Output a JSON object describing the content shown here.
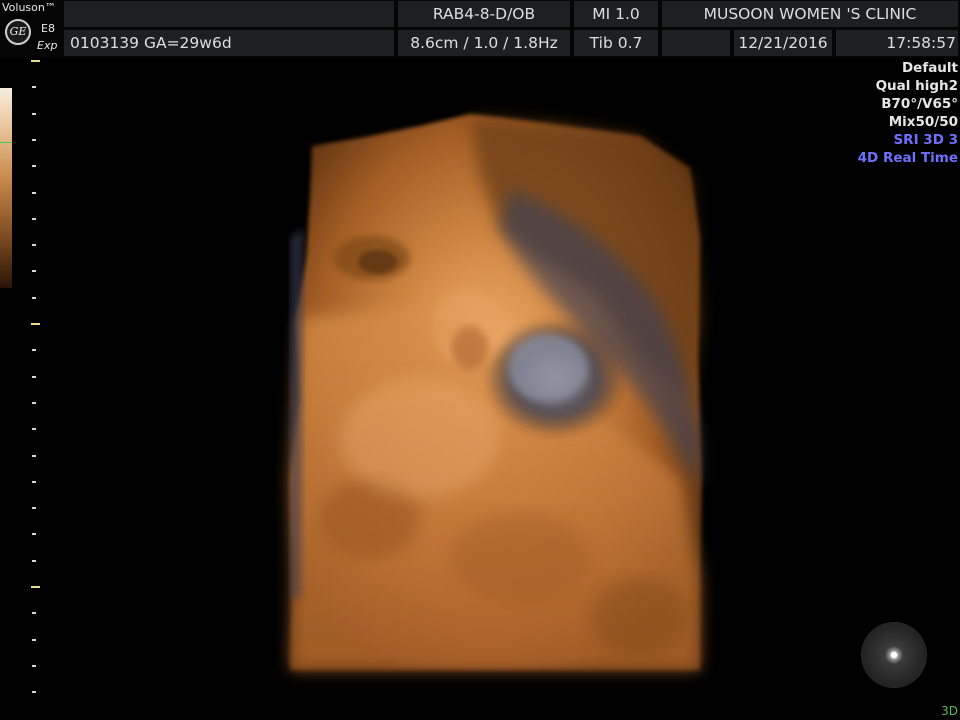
{
  "header": {
    "brand": "Voluson™",
    "logo_text": "GE",
    "model": "E8",
    "model_sub": "Exp",
    "probe": "RAB4-8-D/OB",
    "mi": "MI  1.0",
    "clinic": "MUSOON WOMEN 'S CLINIC",
    "patient_line": "0103139  GA=29w6d",
    "scan_params": "8.6cm / 1.0 / 1.8Hz",
    "tib": "Tib  0.7",
    "date": "12/21/2016",
    "time": "17:58:57"
  },
  "info_panel": {
    "lines_white": [
      "Default",
      "Qual high2",
      "B70°/V65°",
      "Mix50/50"
    ],
    "lines_blue": [
      "SRI 3D 3",
      "4D Real Time"
    ]
  },
  "colors": {
    "accent_blue": "#6f70ff",
    "mode_green": "#4fbf4f",
    "render_tone": "#c47a3c"
  },
  "mode_label": "3D"
}
